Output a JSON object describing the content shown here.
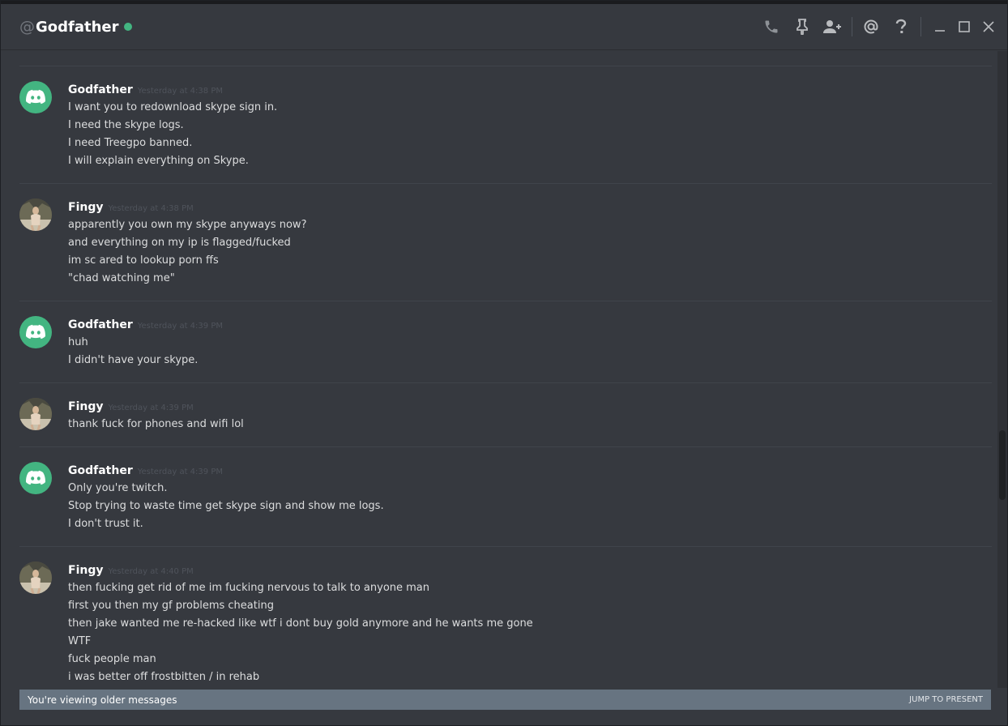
{
  "header": {
    "at_symbol": "@",
    "channel_name": "Godfather",
    "status_color": "#43b581",
    "icons": [
      "phone-icon",
      "pin-icon",
      "add-friend-icon",
      "mention-icon",
      "help-icon",
      "minimize-icon",
      "maximize-icon",
      "close-icon"
    ]
  },
  "messages": [
    {
      "author": "Godfather",
      "avatar": "discord-logo",
      "timestamp": "Yesterday at 4:38 PM",
      "lines": [
        "I want you to redownload skype sign in.",
        "I need the skype logs.",
        "I need Treegpo banned.",
        "I will explain everything on Skype."
      ]
    },
    {
      "author": "Fingy",
      "avatar": "photo",
      "timestamp": "Yesterday at 4:38 PM",
      "lines": [
        "apparently you own my skype anyways now?",
        "and everything on my ip is flagged/fucked",
        "im sc ared to lookup porn ffs",
        "\"chad watching me\""
      ]
    },
    {
      "author": "Godfather",
      "avatar": "discord-logo",
      "timestamp": "Yesterday at 4:39 PM",
      "lines": [
        "huh",
        "I didn't have your skype."
      ]
    },
    {
      "author": "Fingy",
      "avatar": "photo",
      "timestamp": "Yesterday at 4:39 PM",
      "lines": [
        "thank fuck for phones and wifi lol"
      ]
    },
    {
      "author": "Godfather",
      "avatar": "discord-logo",
      "timestamp": "Yesterday at 4:39 PM",
      "lines": [
        "Only you're twitch.",
        "Stop trying to waste time get skype sign and show me logs.",
        "I don't trust it."
      ]
    },
    {
      "author": "Fingy",
      "avatar": "photo",
      "timestamp": "Yesterday at 4:40 PM",
      "lines": [
        "then fucking get rid of me im fucking nervous to talk to anyone man",
        "first you then my gf problems cheating",
        "then jake wanted me re-hacked like wtf i dont buy gold anymore and he wants me gone",
        "WTF",
        "fuck people man",
        "i was better off frostbitten / in rehab"
      ]
    }
  ],
  "banner": {
    "text": "You're viewing older messages",
    "jump_label": "JUMP TO PRESENT",
    "color": "#677481"
  }
}
